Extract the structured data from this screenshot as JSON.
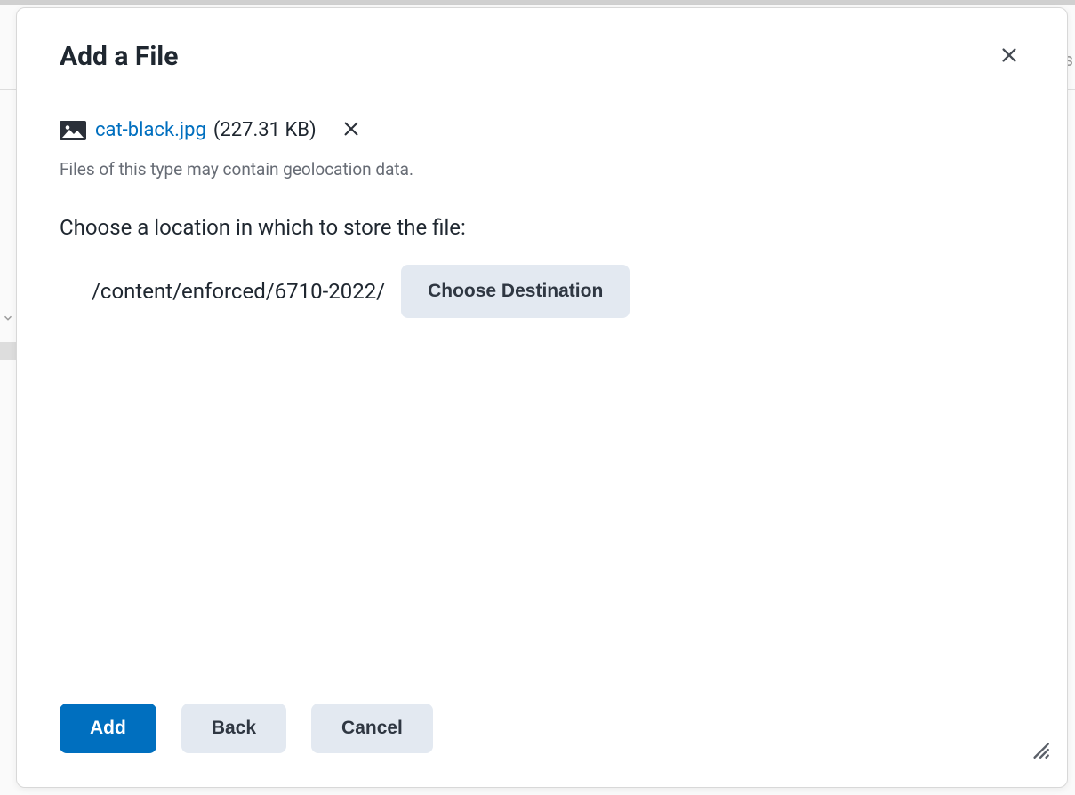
{
  "dialog": {
    "title": "Add a File",
    "file": {
      "name": "cat-black.jpg",
      "size": "(227.31 KB)"
    },
    "geo_warning": "Files of this type may contain geolocation data.",
    "choose_location_label": "Choose a location in which to store the file:",
    "location_path": "/content/enforced/6710-2022/",
    "choose_destination_label": "Choose Destination",
    "buttons": {
      "add": "Add",
      "back": "Back",
      "cancel": "Cancel"
    }
  }
}
